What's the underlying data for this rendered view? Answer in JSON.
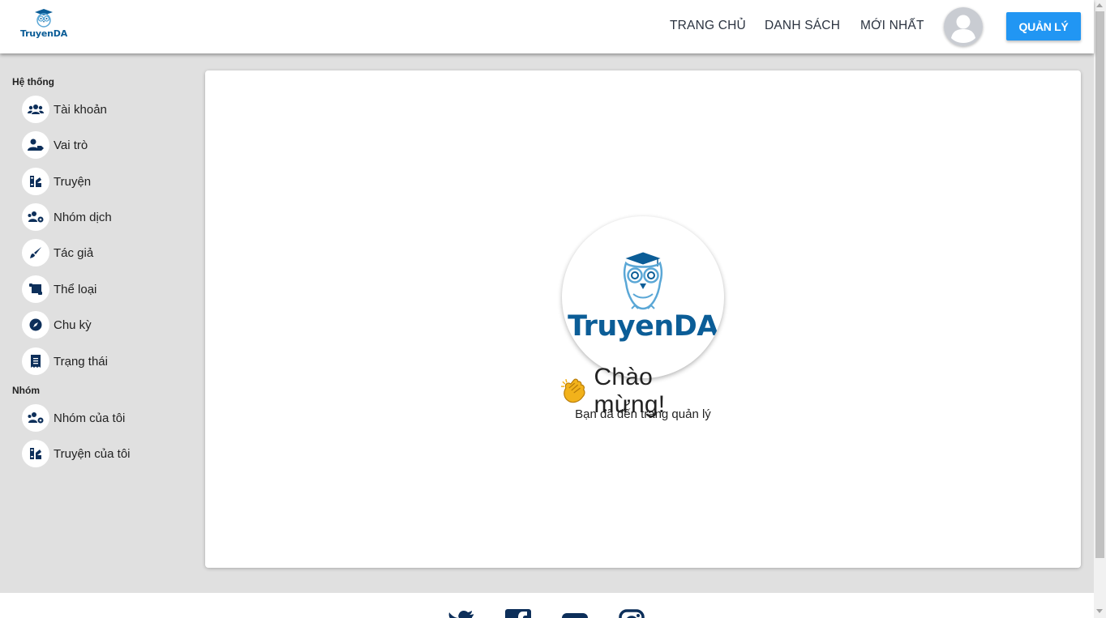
{
  "header": {
    "brand": "TruyenDA",
    "nav": [
      "TRANG CHỦ",
      "DANH SÁCH",
      "MỚI NHẤT"
    ],
    "manage_button": "QUẢN LÝ"
  },
  "sidebar": {
    "sections": [
      {
        "title": "Hệ thống",
        "items": [
          {
            "label": "Tài khoản",
            "icon": "users-icon"
          },
          {
            "label": "Vai trò",
            "icon": "user-tag-icon"
          },
          {
            "label": "Truyện",
            "icon": "book-icon"
          },
          {
            "label": "Nhóm dịch",
            "icon": "users-cog-icon"
          },
          {
            "label": "Tác giả",
            "icon": "brush-icon"
          },
          {
            "label": "Thể loại",
            "icon": "scroll-icon"
          },
          {
            "label": "Chu kỳ",
            "icon": "compass-icon"
          },
          {
            "label": "Trạng thái",
            "icon": "receipt-icon"
          }
        ]
      },
      {
        "title": "Nhóm",
        "items": [
          {
            "label": "Nhóm của tôi",
            "icon": "users-cog-icon"
          },
          {
            "label": "Truyện của tôi",
            "icon": "book-icon"
          }
        ]
      }
    ]
  },
  "main": {
    "logo_text": "TruyenDA",
    "welcome": "Chào mừng!",
    "welcome_emoji": "👏",
    "subtitle": "Bạn đã đến trang quản lý"
  },
  "footer": {
    "social": [
      "twitter-icon",
      "facebook-icon",
      "youtube-icon",
      "instagram-icon"
    ]
  },
  "colors": {
    "brand": "#0b5d97",
    "accent": "#2196f3",
    "sidebar_icon": "#0d2f5a",
    "background": "#e0e0e0"
  }
}
